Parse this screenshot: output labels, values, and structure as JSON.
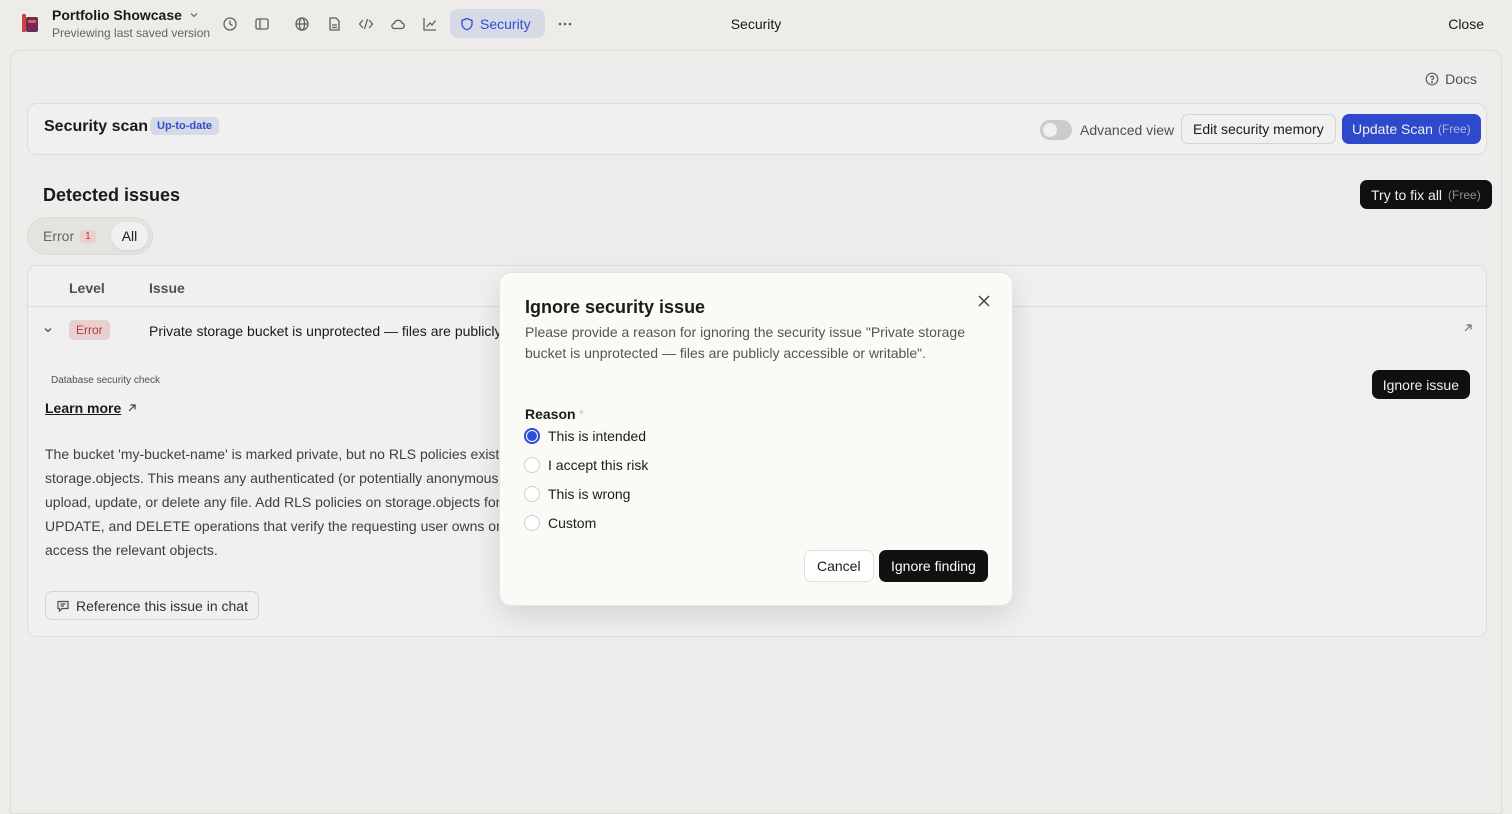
{
  "topbar": {
    "project_name": "Portfolio Showcase",
    "project_subtitle": "Previewing last saved version",
    "active_tab_label": "Security",
    "page_title": "Security",
    "close_label": "Close"
  },
  "main": {
    "docs_label": "Docs",
    "scan": {
      "title": "Security scan",
      "status_badge": "Up-to-date",
      "advanced_view_label": "Advanced view",
      "edit_memory_label": "Edit security memory",
      "update_scan_label": "Update Scan",
      "update_scan_free": "(Free)"
    },
    "issues": {
      "title": "Detected issues",
      "try_fix_label": "Try to fix all",
      "try_fix_free": "(Free)",
      "filters": [
        {
          "label": "Error",
          "count": "1"
        },
        {
          "label": "All"
        }
      ],
      "columns": [
        "Level",
        "Issue"
      ],
      "row": {
        "level": "Error",
        "issue": "Private storage bucket is unprotected — files are publicly",
        "check_label": "Database security check",
        "learn_more": "Learn more",
        "ignore_label": "Ignore issue",
        "description_lines": [
          "The bucket 'my-bucket-name' is marked private, but no RLS policies exist o",
          "storage.objects. This means any authenticated (or potentially anonymous) u",
          "upload, update, or delete any file. Add RLS policies on storage.objects for S",
          "UPDATE, and DELETE operations that verify the requesting user owns or is",
          "access the relevant objects."
        ],
        "reference_label": "Reference this issue in chat"
      }
    }
  },
  "modal": {
    "title": "Ignore security issue",
    "description": "Please provide a reason for ignoring the security issue \"Private storage bucket is unprotected — files are publicly accessible or writable\".",
    "reason_label": "Reason",
    "required_mark": "*",
    "options": [
      {
        "label": "This is intended",
        "selected": true
      },
      {
        "label": "I accept this risk",
        "selected": false
      },
      {
        "label": "This is wrong",
        "selected": false
      },
      {
        "label": "Custom",
        "selected": false
      }
    ],
    "cancel_label": "Cancel",
    "confirm_label": "Ignore finding"
  },
  "colors": {
    "accent": "#2f4fd8",
    "error": "#c43a3a",
    "dark_button": "#111111"
  },
  "icons": [
    "project-logo-icon",
    "chevron-down-icon",
    "history-icon",
    "sidebar-icon",
    "globe-icon",
    "file-icon",
    "code-icon",
    "cloud-icon",
    "chart-icon",
    "shield-icon",
    "more-icon",
    "help-icon",
    "external-link-icon",
    "arrow-up-right-icon",
    "chat-icon",
    "close-icon"
  ]
}
